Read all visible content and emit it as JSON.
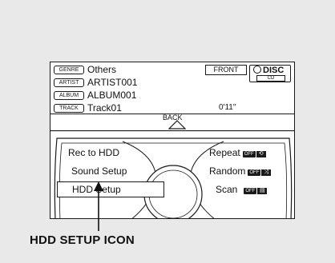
{
  "track_info": {
    "genre_tag": "GENRE",
    "genre": "Others",
    "artist_tag": "ARTIST",
    "artist": "ARTIST001",
    "album_tag": "ALBUM",
    "album": "ALBUM001",
    "track_tag": "TRACK",
    "track": "Track01",
    "time": "0'11''"
  },
  "source": {
    "front": "FRONT",
    "disc": "DISC",
    "disc_sub": "CD"
  },
  "back_label": "BACK",
  "menu": {
    "rec_to_hdd": "Rec to HDD",
    "sound_setup": "Sound Setup",
    "hdd_setup": "HDD Setup",
    "repeat": "Repeat",
    "random": "Random",
    "scan": "Scan",
    "off_badge": "OFF"
  },
  "icons": {
    "repeat": "repeat-icon",
    "random": "shuffle-icon",
    "scan": "scan-icon"
  },
  "caption": "HDD SETUP ICON"
}
